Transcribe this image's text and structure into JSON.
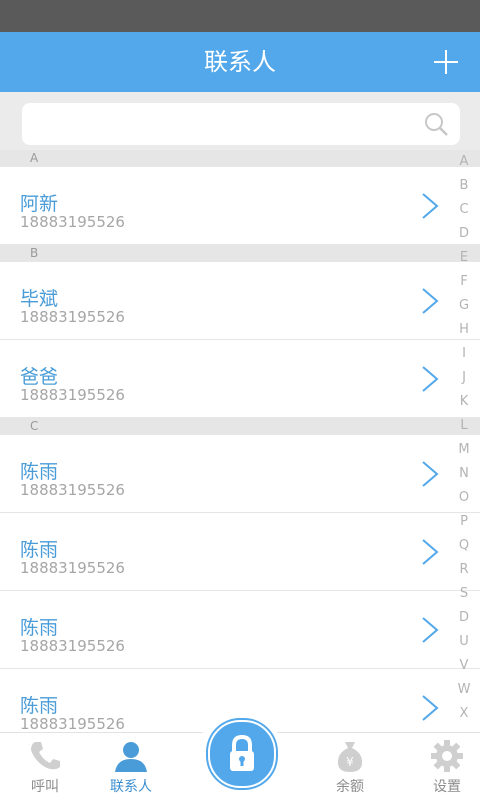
{
  "header": {
    "title": "联系人"
  },
  "search": {
    "placeholder": ""
  },
  "sections": [
    {
      "letter": "A",
      "contacts": [
        {
          "name": "阿新",
          "phone": "18883195526"
        }
      ]
    },
    {
      "letter": "B",
      "contacts": [
        {
          "name": "毕斌",
          "phone": "18883195526"
        },
        {
          "name": "爸爸",
          "phone": "18883195526"
        }
      ]
    },
    {
      "letter": "C",
      "contacts": [
        {
          "name": "陈雨",
          "phone": "18883195526"
        },
        {
          "name": "陈雨",
          "phone": "18883195526"
        },
        {
          "name": "陈雨",
          "phone": "18883195526"
        },
        {
          "name": "陈雨",
          "phone": "18883195526"
        }
      ]
    }
  ],
  "index_letters": [
    "A",
    "B",
    "C",
    "D",
    "E",
    "F",
    "G",
    "H",
    "I",
    "J",
    "K",
    "L",
    "M",
    "N",
    "O",
    "P",
    "Q",
    "R",
    "S",
    "D",
    "U",
    "V",
    "W",
    "X"
  ],
  "tabs": [
    {
      "label": "呼叫",
      "icon": "phone-icon"
    },
    {
      "label": "联系人",
      "icon": "person-icon"
    },
    {
      "label": "",
      "icon": "lock-icon"
    },
    {
      "label": "余额",
      "icon": "money-bag-icon"
    },
    {
      "label": "设置",
      "icon": "gear-icon"
    }
  ],
  "colors": {
    "accent": "#52a8ea",
    "name_text": "#4a9cd8",
    "phone_text": "#a6a6a6"
  }
}
